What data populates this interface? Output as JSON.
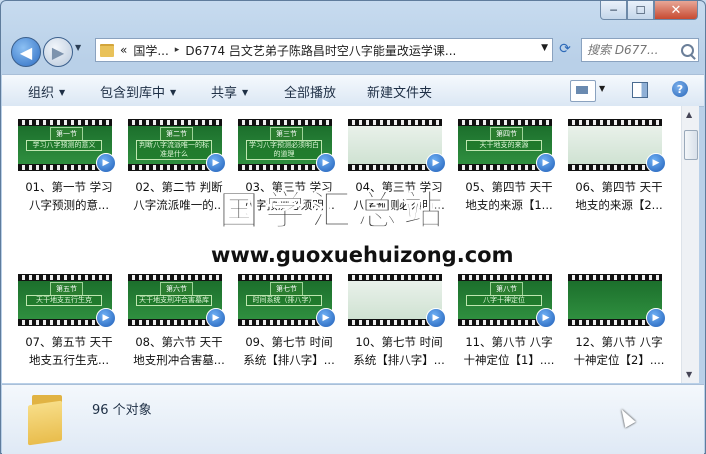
{
  "window": {
    "minimize": "─",
    "maximize": "☐",
    "close": "✕"
  },
  "nav": {
    "back_icon": "back-arrow-icon",
    "forward_icon": "forward-arrow-icon",
    "address": {
      "prefix": "«",
      "crumb1": "国学...",
      "sep": "▸",
      "crumb2": "D6774 吕文艺弟子陈路昌时空八字能量改运学课..."
    },
    "search_placeholder": "搜索 D677..."
  },
  "toolbar": {
    "organize": "组织",
    "include_library": "包含到库中",
    "share": "共享",
    "play_all": "全部播放",
    "new_folder": "新建文件夹"
  },
  "files": [
    {
      "line1": "01、第一节 学习",
      "line2": "八字预测的意...",
      "tag": "第一节",
      "slide": "学习八字预测的意义"
    },
    {
      "line1": "02、第二节 判断",
      "line2": "八字流派唯一的...",
      "tag": "第二节",
      "slide": "判断八字流派唯一的标准是什么"
    },
    {
      "line1": "03、第三节 学习",
      "line2": "八字预测必须明...",
      "tag": "第三节",
      "slide": "学习八字预测必须明白的道理"
    },
    {
      "line1": "04、第三节 学习",
      "line2": "八字预测必须明...",
      "tag": "",
      "slide": ""
    },
    {
      "line1": "05、第四节 天干",
      "line2": "地支的来源【1...",
      "tag": "第四节",
      "slide": "天干地支的来源"
    },
    {
      "line1": "06、第四节 天干",
      "line2": "地支的来源【2...",
      "tag": "",
      "slide": ""
    },
    {
      "line1": "07、第五节 天干",
      "line2": "地支五行生克...",
      "tag": "第五节",
      "slide": "天干地支五行生克"
    },
    {
      "line1": "08、第六节 天干",
      "line2": "地支刑冲合害墓...",
      "tag": "第六节",
      "slide": "天干地支刑冲合害墓库"
    },
    {
      "line1": "09、第七节 时间",
      "line2": "系统【排八字】...",
      "tag": "第七节",
      "slide": "时间系统（排八字）"
    },
    {
      "line1": "10、第七节 时间",
      "line2": "系统【排八字】...",
      "tag": "",
      "slide": ""
    },
    {
      "line1": "11、第八节 八字",
      "line2": "十神定位【1】....",
      "tag": "第八节",
      "slide": "八字十神定位"
    },
    {
      "line1": "12、第八节 八字",
      "line2": "十神定位【2】....",
      "tag": "",
      "slide": ""
    }
  ],
  "watermark": {
    "title": "国学汇总站",
    "url": "www.guoxuehuizong.com"
  },
  "status": {
    "count": "96 个对象"
  }
}
